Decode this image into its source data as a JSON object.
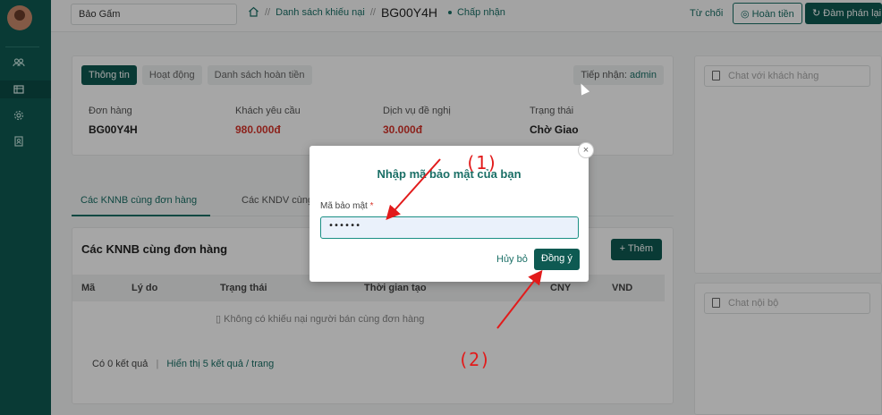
{
  "header": {
    "search_value": "Bảo Gấm",
    "breadcrumb_sep1": "//",
    "breadcrumb_link": "Danh sách khiếu nại",
    "breadcrumb_sep2": "//",
    "ticket_code": "BG00Y4H",
    "status": "Chấp nhận",
    "reject_label": "Từ chối",
    "refund_label": "Hoàn tiền",
    "negotiate_label": "Đàm phán lại"
  },
  "main": {
    "tabs": [
      "Thông tin",
      "Hoạt động",
      "Danh sách hoàn tiền"
    ],
    "receiver_label": "Tiếp nhận:",
    "receiver_value": "admin",
    "info": [
      {
        "label": "Đơn hàng",
        "value": "BG00Y4H"
      },
      {
        "label": "Khách yêu cầu",
        "value": "980.000đ"
      },
      {
        "label": "Dịch vụ đề nghị",
        "value": "30.000đ"
      },
      {
        "label": "Trạng thái",
        "value": "Chờ Giao"
      }
    ]
  },
  "subtabs": [
    "Các KNNB cùng đơn hàng",
    "Các KNDV cùng"
  ],
  "list": {
    "title": "Các KNNB cùng đơn hàng",
    "add_label": "+ Thêm",
    "columns": [
      "Mã",
      "Lý do",
      "Trạng thái",
      "Thời gian tạo",
      "CNY",
      "VND"
    ],
    "empty_text": "Không có khiếu nại người bán cùng đơn hàng",
    "result_count": "Có 0 kết quả",
    "separator": "|",
    "page_size_text": "Hiển thị 5 kết quả / trang"
  },
  "chat": {
    "customer_placeholder": "Chat với khách hàng",
    "internal_placeholder": "Chat nội bộ"
  },
  "modal": {
    "title": "Nhập mã bảo mật của bạn",
    "field_label": "Mã bảo mật",
    "required_mark": "*",
    "field_value": "••••••",
    "cancel_label": "Hủy bỏ",
    "ok_label": "Đồng ý",
    "close_glyph": "×"
  },
  "annotations": {
    "label1": "(1)",
    "label2": "(2)"
  },
  "icons": {
    "home": "home-icon",
    "users": "users-icon",
    "list": "list-icon",
    "settings": "gear-icon",
    "contact": "contact-icon",
    "document": "document-icon",
    "check": "check-circle-icon",
    "refresh": "refresh-icon"
  },
  "colors": {
    "primary": "#0e5a52",
    "accent": "#1a6f66",
    "danger": "#d7352b",
    "annotation": "#e21b1b"
  }
}
